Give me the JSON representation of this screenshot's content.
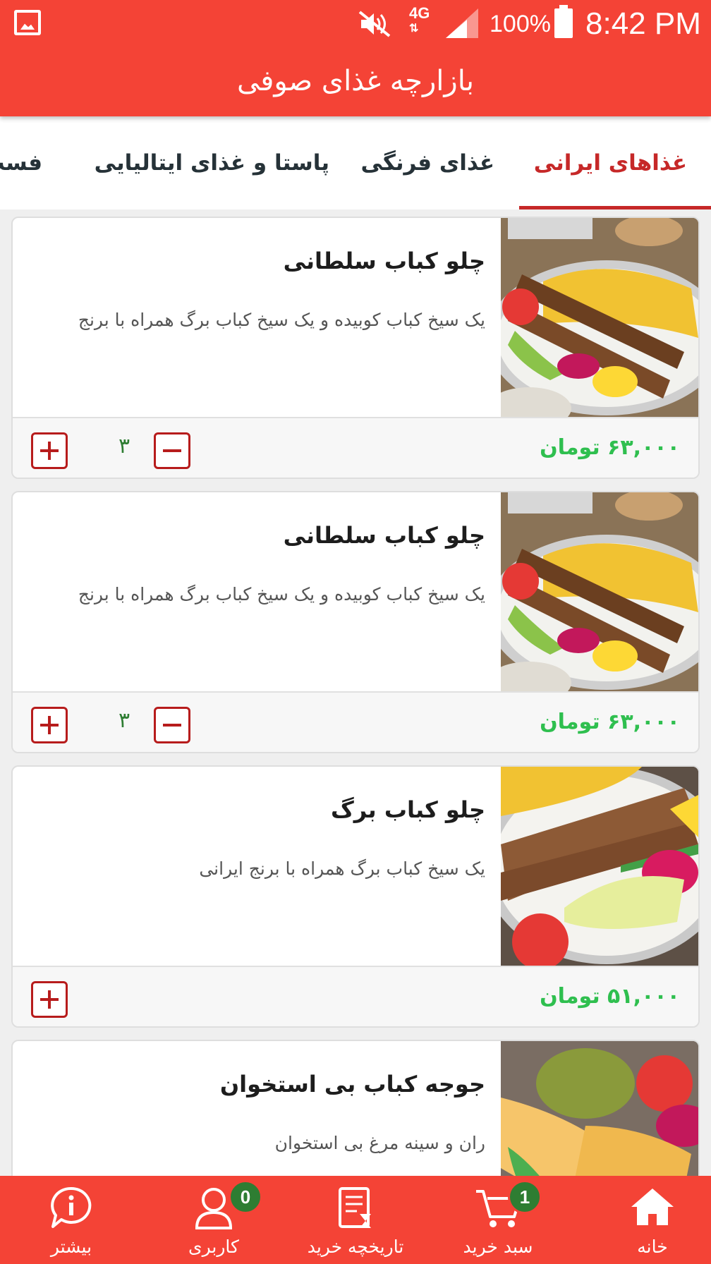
{
  "status_bar": {
    "network": "4G",
    "battery": "100%",
    "time": "8:42 PM"
  },
  "app_bar": {
    "title": "بازارچه غذای صوفی"
  },
  "tabs": [
    {
      "label": "غذاهای ایرانی",
      "active": true
    },
    {
      "label": "غذای فرنگی",
      "active": false
    },
    {
      "label": "پاستا و غذای ایتالیایی",
      "active": false
    },
    {
      "label": "فست",
      "active": false
    }
  ],
  "products": [
    {
      "title": "چلو کباب سلطانی",
      "description": "یک سیخ کباب کوبیده و یک سیخ کباب برگ همراه با برنج",
      "price": "۶۳,۰۰۰ تومان",
      "quantity": "۳"
    },
    {
      "title": "چلو کباب سلطانی",
      "description": "یک سیخ کباب کوبیده و یک سیخ کباب برگ همراه با برنج",
      "price": "۶۳,۰۰۰ تومان",
      "quantity": "۳"
    },
    {
      "title": "چلو کباب برگ",
      "description": "یک سیخ کباب برگ همراه با برنج ایرانی",
      "price": "۵۱,۰۰۰ تومان",
      "quantity": ""
    },
    {
      "title": "جوجه کباب بی استخوان",
      "description": "ران و سینه مرغ بی استخوان",
      "price": "",
      "quantity": ""
    }
  ],
  "bottom_nav": {
    "home": "خانه",
    "cart": "سبد خرید",
    "cart_badge": "1",
    "history": "تاریخچه خرید",
    "user": "کاربری",
    "user_badge": "0",
    "more": "بیشتر"
  },
  "colors": {
    "primary": "#f44336",
    "tab_active": "#c62828",
    "price": "#2fbf4f",
    "badge": "#2e7d32",
    "stepper": "#b71c1c"
  }
}
